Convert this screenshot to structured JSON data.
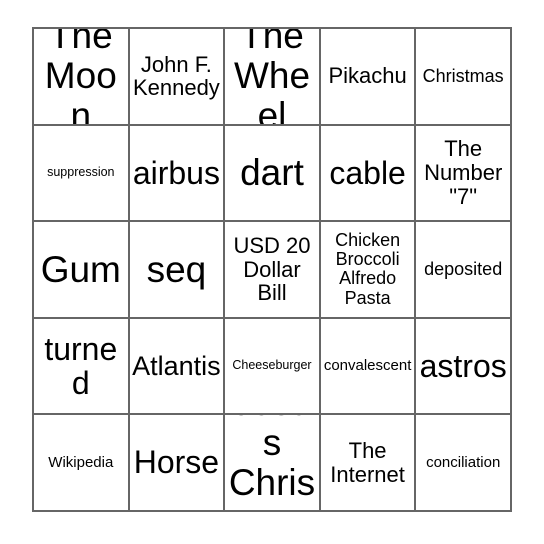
{
  "card": {
    "columns": 5,
    "rows": 5,
    "border_color": "#666666",
    "text_color": "#000000",
    "background_color": "#ffffff",
    "cells": [
      {
        "text": "The\nMoon",
        "size": "xxl"
      },
      {
        "text": "John F.\nKennedy",
        "size": "md"
      },
      {
        "text": "The\nWheel",
        "size": "xxl"
      },
      {
        "text": "Pikachu",
        "size": "md"
      },
      {
        "text": "Christmas",
        "size": "sm"
      },
      {
        "text": "suppression",
        "size": "xxs"
      },
      {
        "text": "airbus",
        "size": "xl"
      },
      {
        "text": "dart",
        "size": "xxl"
      },
      {
        "text": "cable",
        "size": "xl"
      },
      {
        "text": "The\nNumber\n\"7\"",
        "size": "md"
      },
      {
        "text": "Gum",
        "size": "xxl"
      },
      {
        "text": "seq",
        "size": "xxl"
      },
      {
        "text": "USD 20\nDollar\nBill",
        "size": "md"
      },
      {
        "text": "Chicken\nBroccoli\nAlfredo\nPasta",
        "size": "sm"
      },
      {
        "text": "deposited",
        "size": "sm"
      },
      {
        "text": "turned",
        "size": "xl"
      },
      {
        "text": "Atlantis",
        "size": "lg"
      },
      {
        "text": "Cheeseburger",
        "size": "xxs"
      },
      {
        "text": "convalescent",
        "size": "xs"
      },
      {
        "text": "astros",
        "size": "xl"
      },
      {
        "text": "Wikipedia",
        "size": "xs"
      },
      {
        "text": "Horse",
        "size": "xl"
      },
      {
        "text": "Jesus\nChrist",
        "size": "xxl"
      },
      {
        "text": "The\nInternet",
        "size": "md"
      },
      {
        "text": "conciliation",
        "size": "xs"
      }
    ]
  }
}
